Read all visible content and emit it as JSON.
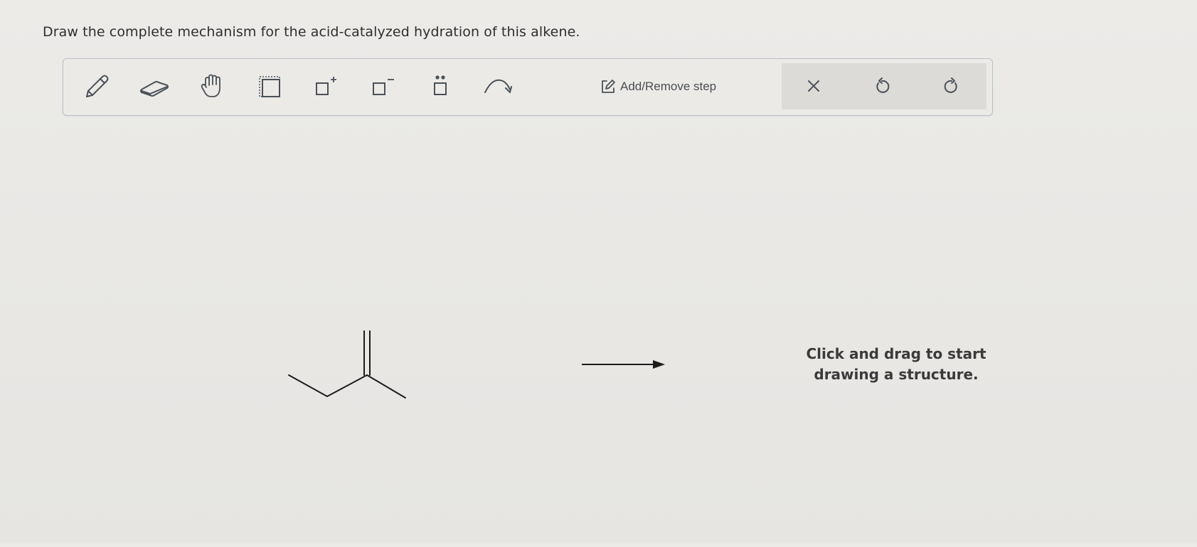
{
  "question": {
    "text": "Draw the complete mechanism for the acid-catalyzed hydration of this alkene."
  },
  "toolbar": {
    "tools": [
      {
        "name": "pencil-tool",
        "icon": "pencil-icon"
      },
      {
        "name": "eraser-tool",
        "icon": "eraser-icon"
      },
      {
        "name": "hand-tool",
        "icon": "hand-icon"
      },
      {
        "name": "select-tool",
        "icon": "lasso-select-icon"
      },
      {
        "name": "positive-charge-tool",
        "icon": "positive-charge-icon"
      },
      {
        "name": "negative-charge-tool",
        "icon": "negative-charge-icon"
      },
      {
        "name": "lone-pair-tool",
        "icon": "lone-pair-icon"
      },
      {
        "name": "curved-arrow-tool",
        "icon": "curved-arrow-icon"
      }
    ],
    "step_button": {
      "label": "Add/Remove step",
      "icon": "edit-icon"
    },
    "actions": [
      {
        "name": "clear-button",
        "icon": "close-icon"
      },
      {
        "name": "undo-button",
        "icon": "undo-icon"
      },
      {
        "name": "redo-button",
        "icon": "redo-icon"
      }
    ]
  },
  "canvas": {
    "molecule": "alkene-skeletal-structure",
    "reaction_arrow": "right-arrow",
    "hint_line1": "Click and drag to start",
    "hint_line2": "drawing a structure."
  },
  "colors": {
    "background": "#ebeae7",
    "toolbar_border": "#b9c0c7",
    "icon": "#4a5058",
    "hint_text": "#3a3a3a"
  }
}
